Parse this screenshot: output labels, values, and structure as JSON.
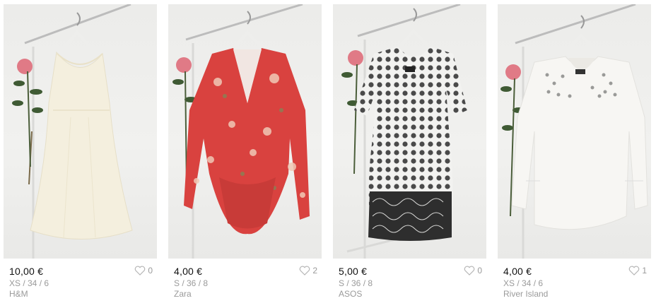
{
  "items": [
    {
      "price": "10,00 €",
      "size": "XS / 34 / 6",
      "brand": "H&M",
      "favorites": "0",
      "image_icon": "cream-dress-on-hanger"
    },
    {
      "price": "4,00 €",
      "size": "S / 36 / 8",
      "brand": "Zara",
      "favorites": "2",
      "image_icon": "red-floral-bodysuit-on-hanger"
    },
    {
      "price": "5,00 €",
      "size": "S / 36 / 8",
      "brand": "ASOS",
      "favorites": "0",
      "image_icon": "polka-dot-dress-on-hanger"
    },
    {
      "price": "4,00 €",
      "size": "XS / 34 / 6",
      "brand": "River Island",
      "favorites": "1",
      "image_icon": "white-embellished-blouse-on-hanger"
    }
  ],
  "colors": {
    "price_text": "#111111",
    "meta_text": "#9a9a9a",
    "heart_outline": "#b5b5b5",
    "photo_bg": "#efefed"
  }
}
